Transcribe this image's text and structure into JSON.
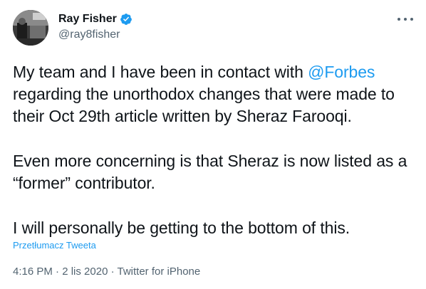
{
  "author": {
    "name": "Ray Fisher",
    "handle": "@ray8fisher",
    "verified_color": "#1d9bf0"
  },
  "tweet": {
    "line1_prefix": "My team and I have been in contact with ",
    "mention": "@Forbes",
    "line1_rest": "regarding the unorthodox changes that were made to their Oct 29th article written by Sheraz Farooqi.",
    "paragraph2": "Even more concerning is that Sheraz is now listed as a “former” contributor.",
    "paragraph3": "I will personally be getting to the bottom of this."
  },
  "translate_label": "Przetłumacz Tweeta",
  "meta": {
    "time": "4:16 PM",
    "sep1": " · ",
    "date": "2 lis 2020",
    "sep2": " · ",
    "source": "Twitter for iPhone"
  },
  "colors": {
    "link": "#1d9bf0",
    "muted": "#536471",
    "text": "#0f1419"
  },
  "icons": {
    "verified": "verified-badge-icon",
    "more": "more-options-icon"
  }
}
